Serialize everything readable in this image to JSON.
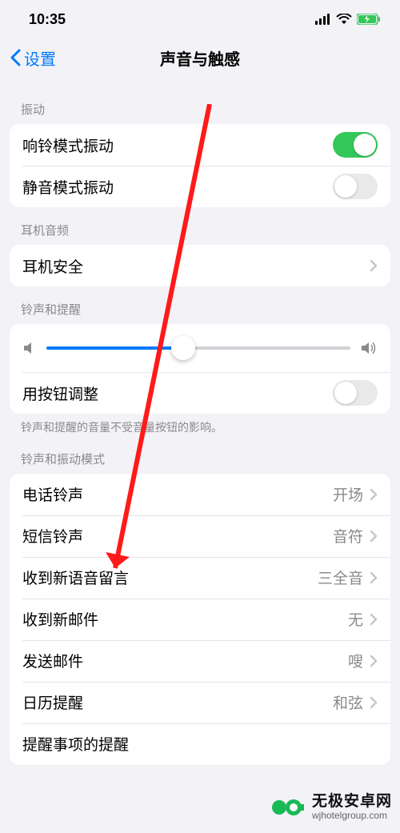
{
  "status": {
    "time": "10:35"
  },
  "nav": {
    "back": "设置",
    "title": "声音与触感"
  },
  "sections": {
    "vibrate": {
      "header": "振动",
      "ringOn": "响铃模式振动",
      "silentOn": "静音模式振动"
    },
    "headphone": {
      "header": "耳机音频",
      "safety": "耳机安全"
    },
    "ringer": {
      "header": "铃声和提醒",
      "volume_percent": 45,
      "buttonAdjust": "用按钮调整",
      "footer": "铃声和提醒的音量不受音量按钮的影响。"
    },
    "patterns": {
      "header": "铃声和振动模式",
      "items": [
        {
          "label": "电话铃声",
          "value": "开场"
        },
        {
          "label": "短信铃声",
          "value": "音符"
        },
        {
          "label": "收到新语音留言",
          "value": "三全音"
        },
        {
          "label": "收到新邮件",
          "value": "无"
        },
        {
          "label": "发送邮件",
          "value": "嗖"
        },
        {
          "label": "日历提醒",
          "value": "和弦"
        },
        {
          "label": "提醒事项的提醒",
          "value": ""
        }
      ]
    }
  },
  "watermark": {
    "name": "无极安卓网",
    "url": "wjhotelgroup.com"
  }
}
